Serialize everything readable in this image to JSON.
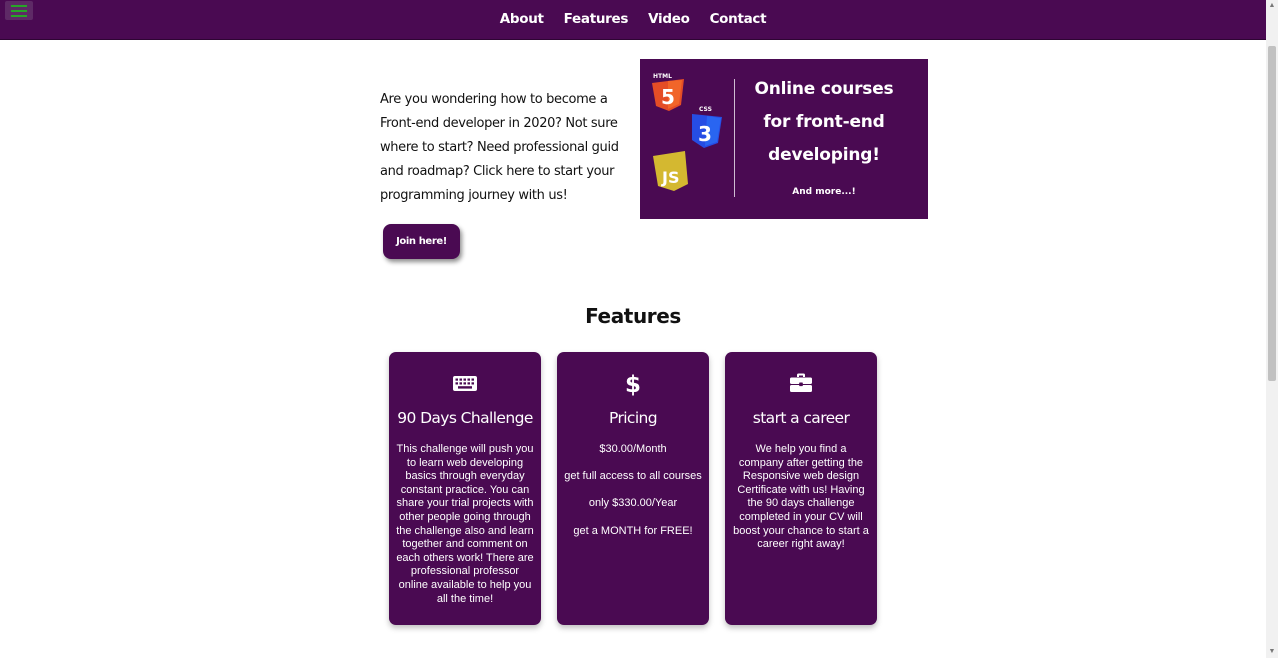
{
  "nav": {
    "menu_icon": "hamburger-menu-icon",
    "links": [
      "About",
      "Features",
      "Video",
      "Contact"
    ]
  },
  "hero": {
    "text": "Are you wondering how to become a Front-end developer in 2020? Not sure where to start? Need professional guid and roadmap? Click here to start your programming journey with us!",
    "button_label": "Join here!"
  },
  "banner": {
    "line1": "Online courses",
    "line2": "for front-end",
    "line3": "developing!",
    "sub": "And more...!",
    "logos": [
      "html5-logo",
      "css3-logo",
      "js-logo"
    ],
    "logo_labels": {
      "html": "HTML",
      "css": "CSS",
      "js": "JS"
    }
  },
  "features": {
    "heading": "Features",
    "cards": [
      {
        "icon": "keyboard-icon",
        "title": "90 Days Challenge",
        "text": "This challenge will push you to learn web developing basics through everyday constant practice. You can share your trial projects with other people going through the challenge also and learn together and comment on each others work! There are professional professor online available to help you all the time!"
      },
      {
        "icon": "dollar-icon",
        "title": "Pricing",
        "lines": [
          "$30.00/Month",
          "get full access to all courses",
          "only $330.00/Year",
          "get a MONTH for FREE!"
        ]
      },
      {
        "icon": "briefcase-icon",
        "title": "start a career",
        "text": "We help you find a company after getting the Responsive web design Certificate with us! Having the 90 days challenge completed in your CV will boost your chance to start a career right away!"
      }
    ]
  },
  "colors": {
    "brand": "#4a0a52",
    "menu_icon": "#28a428",
    "html5": "#e44d26",
    "css3": "#264de4",
    "js": "#d4b830"
  }
}
